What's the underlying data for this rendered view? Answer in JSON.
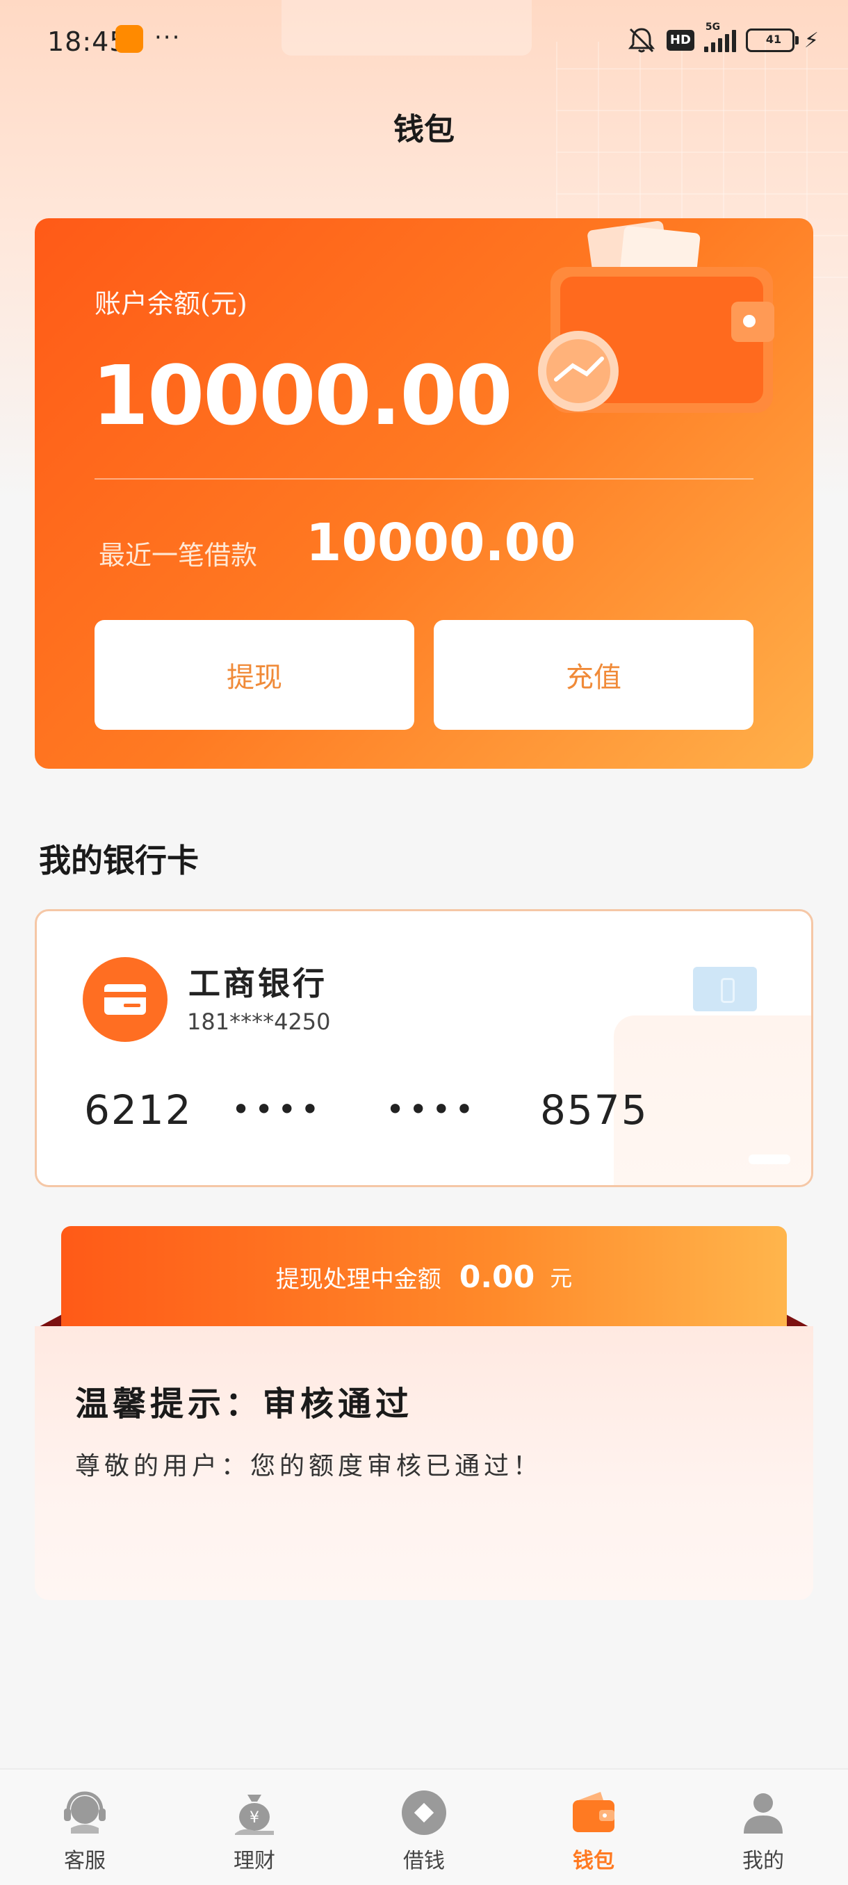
{
  "status_bar": {
    "time": "18:45",
    "more": "···",
    "hd": "HD",
    "network": "5G",
    "battery": "41"
  },
  "page": {
    "title": "钱包"
  },
  "balance": {
    "label": "账户余额(元)",
    "amount": "10000.00",
    "recent_label": "最近一笔借款",
    "recent_amount": "10000.00",
    "withdraw_label": "提现",
    "recharge_label": "充值"
  },
  "bank_section": {
    "title": "我的银行卡",
    "card": {
      "bank_name": "工商银行",
      "phone": "181****4250",
      "number_parts": [
        "6212",
        "••••",
        "••••",
        "8575"
      ]
    }
  },
  "processing": {
    "label": "提现处理中金额",
    "amount": "0.00",
    "unit": "元"
  },
  "notice": {
    "title": "温馨提示：审核通过",
    "text": "尊敬的用户：您的额度审核已通过！"
  },
  "nav": {
    "items": [
      {
        "label": "客服",
        "icon": "headset-icon",
        "active": false
      },
      {
        "label": "理财",
        "icon": "money-bag-icon",
        "active": false
      },
      {
        "label": "借钱",
        "icon": "diamond-icon",
        "active": false
      },
      {
        "label": "钱包",
        "icon": "wallet-icon",
        "active": true
      },
      {
        "label": "我的",
        "icon": "person-icon",
        "active": false
      }
    ]
  },
  "colors": {
    "accent": "#ff7a22",
    "card_gradient_start": "#ff5a17",
    "card_gradient_end": "#ffb04a"
  }
}
